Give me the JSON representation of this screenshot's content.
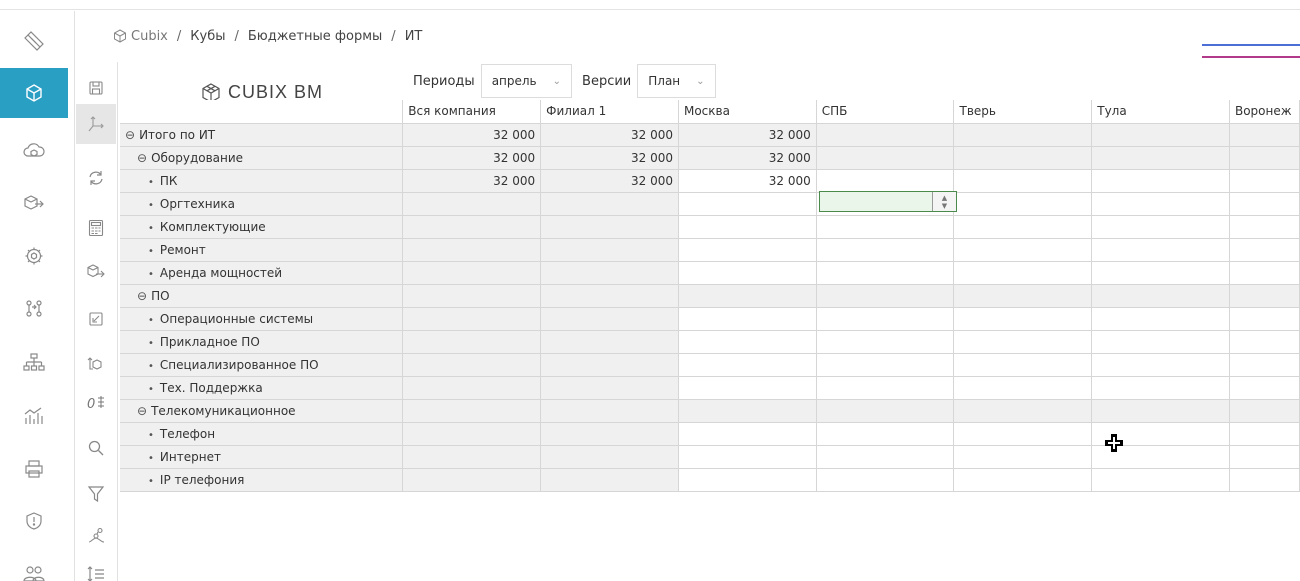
{
  "breadcrumb": [
    "Cubix",
    "Кубы",
    "Бюджетные формы",
    "ИТ"
  ],
  "logo": {
    "text": "CUBIX BM"
  },
  "filters": {
    "periods_label": "Периоды",
    "period_value": "апрель",
    "versions_label": "Версии",
    "version_value": "План"
  },
  "columns": [
    "Вся компания",
    "Филиал 1",
    "Москва",
    "СПБ",
    "Тверь",
    "Тула",
    "Воронеж"
  ],
  "rows": [
    {
      "label": "Итого по ИТ",
      "level": 0,
      "values": [
        "32 000",
        "32 000",
        "32 000",
        "",
        "",
        "",
        ""
      ]
    },
    {
      "label": "Оборудование",
      "level": 1,
      "values": [
        "32 000",
        "32 000",
        "32 000",
        "",
        "",
        "",
        ""
      ]
    },
    {
      "label": "ПК",
      "level": 2,
      "values": [
        "32 000",
        "32 000",
        "32 000",
        "",
        "",
        "",
        ""
      ]
    },
    {
      "label": "Оргтехника",
      "level": 2,
      "values": [
        "",
        "",
        "",
        "",
        "",
        "",
        ""
      ]
    },
    {
      "label": "Комплектующие",
      "level": 2,
      "values": [
        "",
        "",
        "",
        "",
        "",
        "",
        ""
      ]
    },
    {
      "label": "Ремонт",
      "level": 2,
      "values": [
        "",
        "",
        "",
        "",
        "",
        "",
        ""
      ]
    },
    {
      "label": "Аренда мощностей",
      "level": 2,
      "values": [
        "",
        "",
        "",
        "",
        "",
        "",
        ""
      ]
    },
    {
      "label": "ПО",
      "level": 1,
      "values": [
        "",
        "",
        "",
        "",
        "",
        "",
        ""
      ]
    },
    {
      "label": "Операционные системы",
      "level": 2,
      "values": [
        "",
        "",
        "",
        "",
        "",
        "",
        ""
      ]
    },
    {
      "label": "Прикладное ПО",
      "level": 2,
      "values": [
        "",
        "",
        "",
        "",
        "",
        "",
        ""
      ]
    },
    {
      "label": "Специализированное ПО",
      "level": 2,
      "values": [
        "",
        "",
        "",
        "",
        "",
        "",
        ""
      ]
    },
    {
      "label": "Тех. Поддержка",
      "level": 2,
      "values": [
        "",
        "",
        "",
        "",
        "",
        "",
        ""
      ]
    },
    {
      "label": "Телекомуникационное",
      "level": 1,
      "values": [
        "",
        "",
        "",
        "",
        "",
        "",
        ""
      ]
    },
    {
      "label": "Телефон",
      "level": 2,
      "values": [
        "",
        "",
        "",
        "",
        "",
        "",
        ""
      ]
    },
    {
      "label": "Интернет",
      "level": 2,
      "values": [
        "",
        "",
        "",
        "",
        "",
        "",
        ""
      ]
    },
    {
      "label": "IP телефония",
      "level": 2,
      "values": [
        "",
        "",
        "",
        "",
        "",
        "",
        ""
      ]
    }
  ],
  "nav_icons": [
    "tape-icon",
    "cube-icon",
    "cloud-cube-icon",
    "transfer-cube-icon",
    "settings-cube-icon",
    "hierarchy-swap-icon",
    "org-structure-icon",
    "analytics-icon",
    "printer-icon",
    "shield-icon",
    "users-icon"
  ],
  "tool_icons": [
    "save-icon",
    "axes-icon",
    "refresh-icon",
    "calculator-icon",
    "export-cube-icon",
    "import-icon",
    "data-transfer-icon",
    "decimal-icon",
    "search-icon",
    "filter-icon",
    "tree-icon",
    "sort-icon"
  ],
  "colors": {
    "accent": "#2a9fc4",
    "grey_cell": "#f0f0f0",
    "edit_cell": "#eaf6e9"
  }
}
